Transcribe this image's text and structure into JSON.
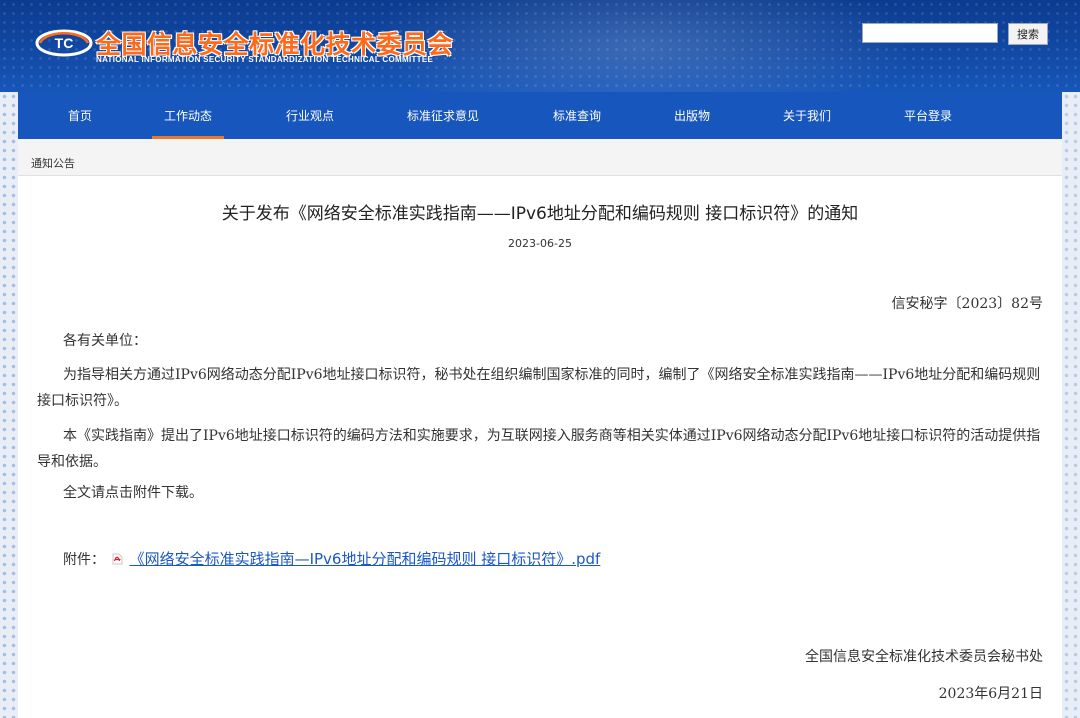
{
  "header": {
    "logo_mark_text": "TC",
    "org_name_cn": "全国信息安全标准化技术委员会",
    "org_name_en": "NATIONAL INFORMATION SECURITY STANDARDIZATION TECHNICAL COMMITTEE",
    "search": {
      "value": "",
      "placeholder": "",
      "button_label": "搜索"
    }
  },
  "nav": {
    "items": [
      {
        "label": "首页",
        "active": false
      },
      {
        "label": "工作动态",
        "active": true
      },
      {
        "label": "行业观点",
        "active": false
      },
      {
        "label": "标准征求意见",
        "active": false
      },
      {
        "label": "标准查询",
        "active": false
      },
      {
        "label": "出版物",
        "active": false
      },
      {
        "label": "关于我们",
        "active": false
      },
      {
        "label": "平台登录",
        "active": false
      }
    ]
  },
  "breadcrumb": "通知公告",
  "article": {
    "title": "关于发布《网络安全标准实践指南——IPv6地址分配和编码规则 接口标识符》的通知",
    "date": "2023-06-25",
    "doc_number": "信安秘字〔2023〕82号",
    "salutation": "各有关单位：",
    "paragraphs": [
      "为指导相关方通过IPv6网络动态分配IPv6地址接口标识符，秘书处在组织编制国家标准的同时，编制了《网络安全标准实践指南——IPv6地址分配和编码规则 接口标识符》。",
      "本《实践指南》提出了IPv6地址接口标识符的编码方法和实施要求，为互联网接入服务商等相关实体通过IPv6网络动态分配IPv6地址接口标识符的活动提供指导和依据。",
      "全文请点击附件下载。"
    ],
    "attachment_label": "附件：",
    "attachment_link": "《网络安全标准实践指南—IPv6地址分配和编码规则 接口标识符》.pdf",
    "signature": "全国信息安全标准化技术委员会秘书处",
    "sign_date": "2023年6月21日"
  },
  "colors": {
    "header_bg": "#0b3b8f",
    "nav_bg": "#1756bd",
    "nav_active_underline": "#e8792b",
    "logo_text": "#ff6a1a",
    "link": "#1a57c8"
  }
}
